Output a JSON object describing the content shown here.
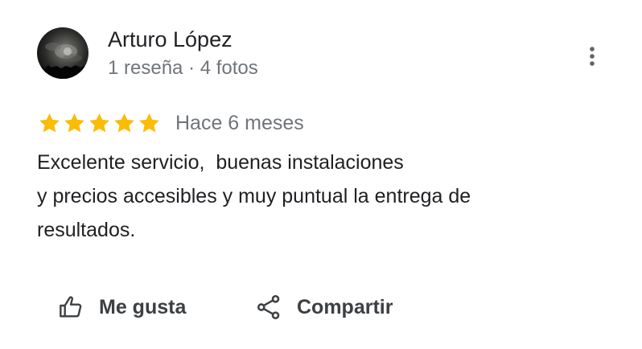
{
  "review": {
    "author": {
      "name": "Arturo López",
      "meta": "1 reseña · 4 fotos"
    },
    "rating": 5,
    "max_rating": 5,
    "date": "Hace 6 meses",
    "text_lines": [
      "Excelente servicio,  buenas instalaciones",
      "y precios accesibles y muy puntual la entrega de",
      "resultados."
    ]
  },
  "actions": {
    "like_label": "Me gusta",
    "share_label": "Compartir"
  },
  "icons": {
    "more": "more-vert-icon",
    "like": "thumb-up-icon",
    "share": "share-icon",
    "star": "star-icon"
  },
  "colors": {
    "star": "#fbbc04",
    "primary_text": "#202124",
    "secondary_text": "#70757a",
    "action_text": "#3c4043"
  }
}
